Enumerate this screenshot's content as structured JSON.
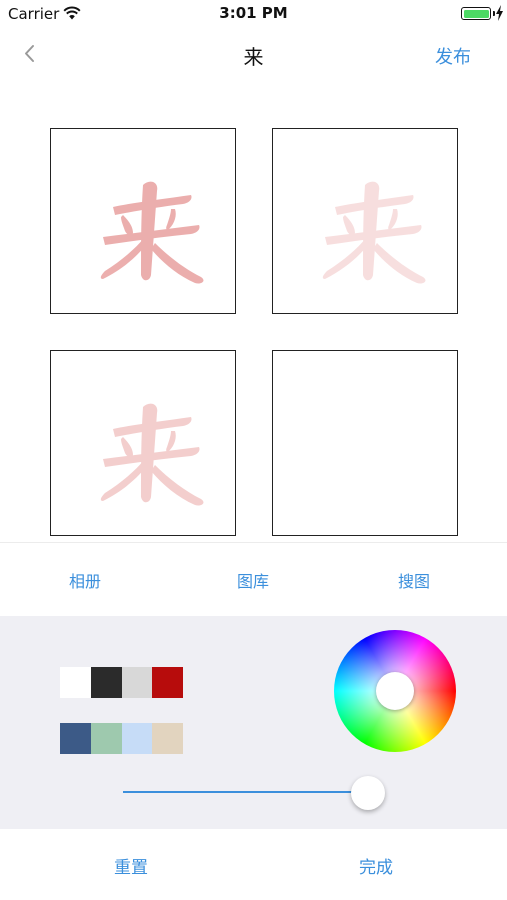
{
  "status_bar": {
    "carrier": "Carrier",
    "time": "3:01 PM",
    "battery_color": "#4cd964"
  },
  "nav": {
    "back_icon": "chevron-left-icon",
    "title": "来",
    "publish_label": "发布"
  },
  "grid": {
    "cells": [
      {
        "glyph": "来",
        "opacity": 0.5
      },
      {
        "glyph": "来",
        "opacity": 0.2
      },
      {
        "glyph": "来",
        "opacity": 0.3
      },
      {
        "glyph": "",
        "opacity": 0
      }
    ],
    "glyph_color": "#d9605e"
  },
  "source_tabs": {
    "album_label": "相册",
    "gallery_label": "图库",
    "search_label": "搜图"
  },
  "palette": {
    "swatches": [
      "#ffffff",
      "#2b2b2b",
      "#d8d8d8",
      "#b70c0c",
      "#3c5a87",
      "#9ec9ae",
      "#c6dcf7",
      "#e2d4bf"
    ]
  },
  "opacity_slider": {
    "value": 1.0
  },
  "bottom": {
    "reset_label": "重置",
    "done_label": "完成"
  },
  "accent_color": "#3b8fdc"
}
